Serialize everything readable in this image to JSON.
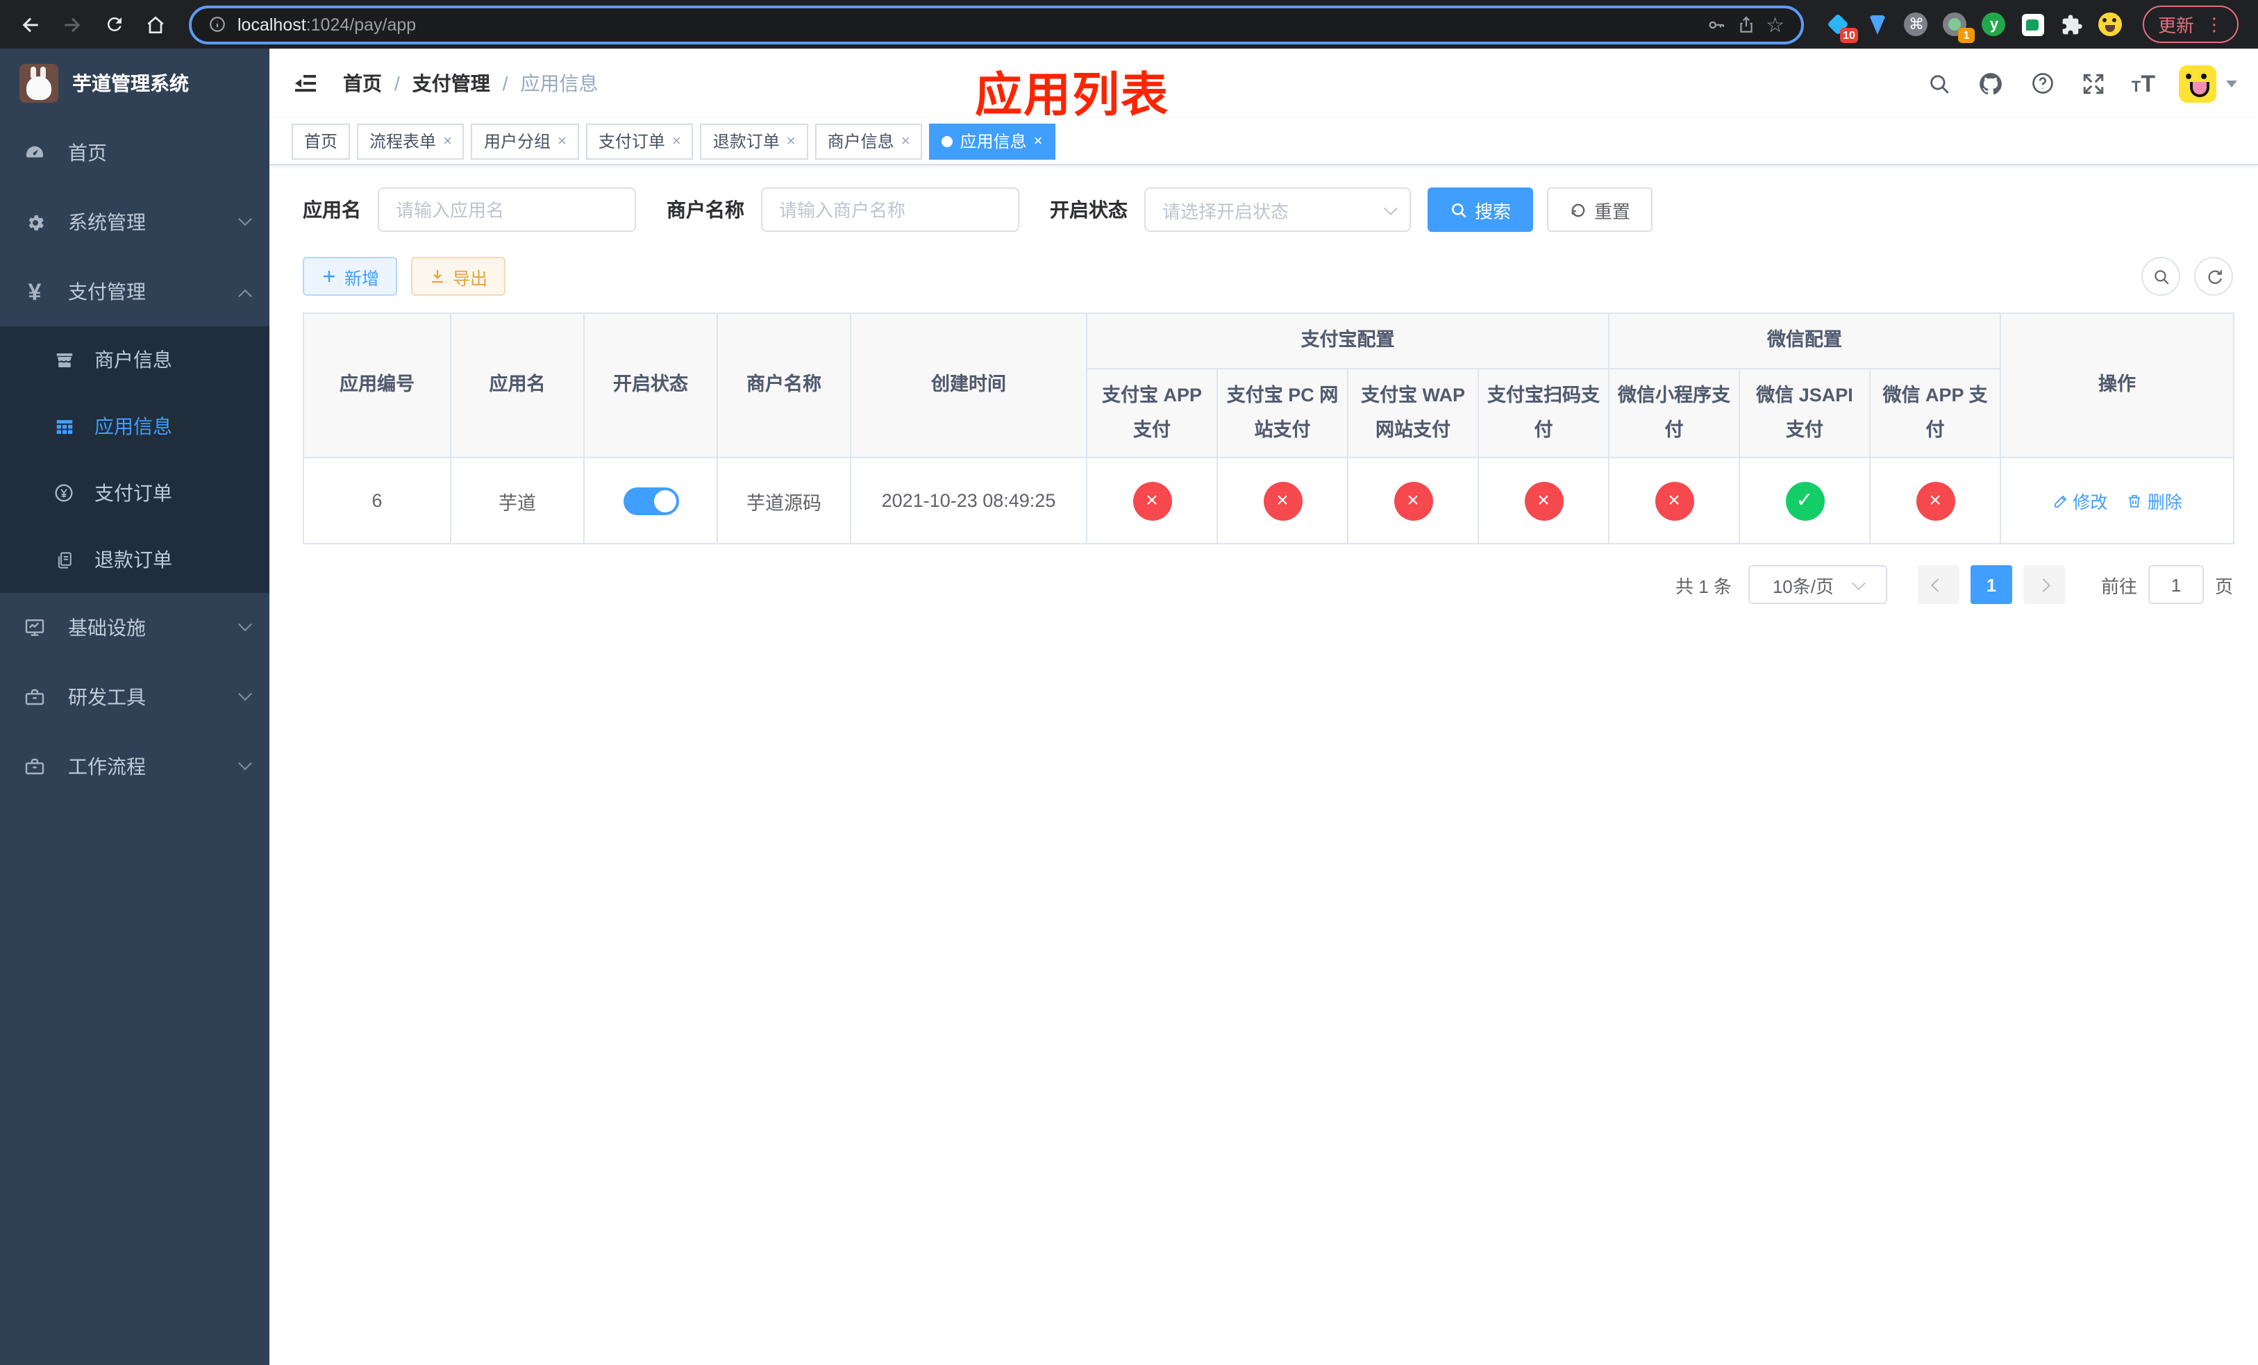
{
  "browser": {
    "url": {
      "host": "localhost",
      "path": ":1024/pay/app"
    },
    "update_label": "更新",
    "menu_dots": "⋮",
    "ext_badge_pin": "10",
    "ext_badge_tab": "1",
    "ext_y_letter": "y",
    "ext_cmd_glyph": "⌘",
    "star_glyph": "☆"
  },
  "sidebar": {
    "logo_title": "芋道管理系统",
    "menu": [
      {
        "label": "首页"
      },
      {
        "label": "系统管理"
      },
      {
        "label": "支付管理"
      },
      {
        "label": "商户信息"
      },
      {
        "label": "应用信息"
      },
      {
        "label": "支付订单"
      },
      {
        "label": "退款订单"
      },
      {
        "label": "基础设施"
      },
      {
        "label": "研发工具"
      },
      {
        "label": "工作流程"
      }
    ],
    "yen_glyph": "¥"
  },
  "header": {
    "breadcrumb": [
      "首页",
      "支付管理",
      "应用信息"
    ],
    "separator": "/",
    "annotation": "应用列表"
  },
  "tabs": [
    {
      "label": "首页"
    },
    {
      "label": "流程表单"
    },
    {
      "label": "用户分组"
    },
    {
      "label": "支付订单"
    },
    {
      "label": "退款订单"
    },
    {
      "label": "商户信息"
    },
    {
      "label": "应用信息"
    }
  ],
  "tab_close_glyph": "×",
  "filters": {
    "app_name_label": "应用名",
    "app_name_placeholder": "请输入应用名",
    "merchant_label": "商户名称",
    "merchant_placeholder": "请输入商户名称",
    "status_label": "开启状态",
    "status_placeholder": "请选择开启状态",
    "search_button": "搜索",
    "reset_button": "重置"
  },
  "toolbar": {
    "add_button": "新增",
    "export_button": "导出"
  },
  "table": {
    "headers": {
      "app_id": "应用编号",
      "app_name": "应用名",
      "status": "开启状态",
      "merchant": "商户名称",
      "create_time": "创建时间",
      "alipay_group": "支付宝配置",
      "wechat_group": "微信配置",
      "alipay_app": "支付宝 APP 支付",
      "alipay_pc": "支付宝 PC 网站支付",
      "alipay_wap": "支付宝 WAP 网站支付",
      "alipay_qr": "支付宝扫码支付",
      "wx_mini": "微信小程序支付",
      "wx_jsapi": "微信 JSAPI 支付",
      "wx_app": "微信 APP 支付",
      "actions": "操作"
    },
    "row": {
      "id": "6",
      "name": "芋道",
      "enabled": true,
      "merchant": "芋道源码",
      "created": "2021-10-23 08:49:25",
      "statuses": [
        "error",
        "error",
        "error",
        "error",
        "error",
        "success",
        "error"
      ],
      "edit_label": "修改",
      "delete_label": "删除"
    }
  },
  "pagination": {
    "total": "共 1 条",
    "page_size": "10条/页",
    "page": "1",
    "goto_label": "前往",
    "goto_value": "1",
    "unit_label": "页"
  },
  "colors": {
    "primary": "#409eff",
    "success": "#13ce66",
    "danger": "#f5494d",
    "warning": "#e6a23c",
    "sidebar_bg": "#304156",
    "submenu_bg": "#1f2d3d",
    "annotation_red": "#fe2400",
    "tab_border": "#d8dce5"
  }
}
